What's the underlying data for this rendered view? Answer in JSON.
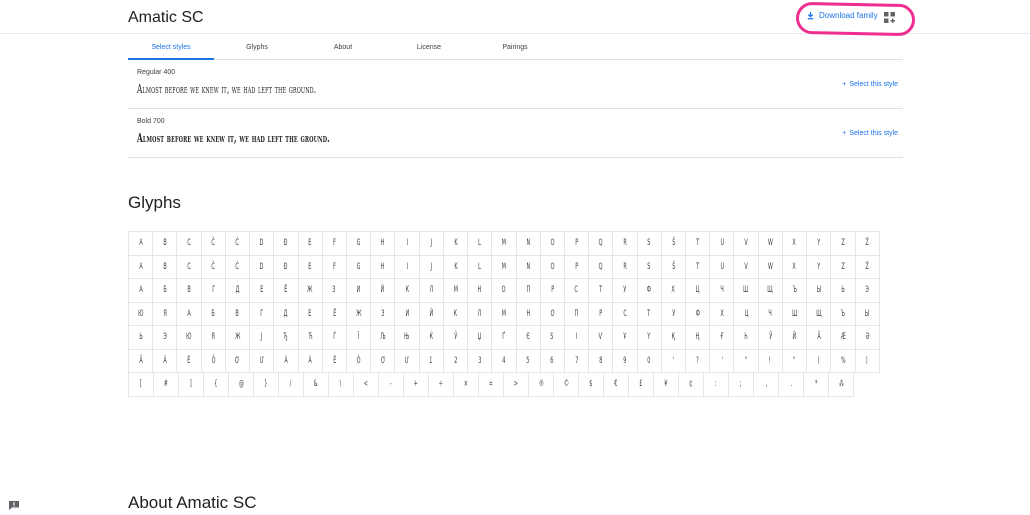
{
  "header": {
    "family_title": "Amatic SC",
    "download_label": "Download family"
  },
  "tabs": [
    "Select styles",
    "Glyphs",
    "About",
    "License",
    "Pairings"
  ],
  "active_tab": "Select styles",
  "styles": [
    {
      "name": "Regular 400",
      "sample": "Almost before we knew it, we had left the ground.",
      "action": "Select this style"
    },
    {
      "name": "Bold 700",
      "sample": "Almost before we knew it, we had left the ground.",
      "action": "Select this style"
    }
  ],
  "sections": {
    "glyphs_title": "Glyphs",
    "about_title": "About Amatic SC"
  },
  "glyph_rows": [
    [
      "A",
      "B",
      "C",
      "Č",
      "Ć",
      "D",
      "Đ",
      "E",
      "F",
      "G",
      "H",
      "I",
      "J",
      "K",
      "L",
      "M",
      "N",
      "O",
      "P",
      "Q",
      "R",
      "S",
      "Š",
      "T",
      "U",
      "V",
      "W",
      "X",
      "Y",
      "Z",
      "Ž"
    ],
    [
      "A",
      "B",
      "C",
      "Č",
      "Ć",
      "D",
      "Đ",
      "E",
      "F",
      "G",
      "H",
      "I",
      "J",
      "K",
      "L",
      "M",
      "N",
      "O",
      "P",
      "Q",
      "R",
      "S",
      "Š",
      "T",
      "U",
      "V",
      "W",
      "X",
      "Y",
      "Z",
      "Ž"
    ],
    [
      "А",
      "Б",
      "В",
      "Г",
      "Д",
      "Е",
      "Ё",
      "Ж",
      "З",
      "И",
      "Й",
      "К",
      "Л",
      "М",
      "Н",
      "О",
      "П",
      "Р",
      "С",
      "Т",
      "У",
      "Ф",
      "Х",
      "Ц",
      "Ч",
      "Ш",
      "Щ",
      "Ъ",
      "Ы",
      "Ь",
      "Э"
    ],
    [
      "Ю",
      "Я",
      "А",
      "Б",
      "В",
      "Г",
      "Д",
      "Е",
      "Ё",
      "Ж",
      "З",
      "И",
      "Й",
      "К",
      "Л",
      "М",
      "Н",
      "О",
      "П",
      "Р",
      "С",
      "Т",
      "У",
      "Ф",
      "Х",
      "Ц",
      "Ч",
      "Ш",
      "Щ",
      "Ъ",
      "Ы"
    ],
    [
      "Ь",
      "Э",
      "Ю",
      "Я",
      "Ж",
      "Ј",
      "Ђ",
      "Ћ",
      "Ѓ",
      "Ї",
      "Љ",
      "Њ",
      "Ќ",
      "Ў",
      "Џ",
      "Ґ",
      "Є",
      "Ѕ",
      "І",
      "Ѵ",
      "Ұ",
      "Ү",
      "Қ",
      "Ң",
      "Ғ",
      "Һ",
      "Ӯ",
      "Ӣ",
      "Ӑ",
      "Ӕ",
      "Ә"
    ],
    [
      "Ă",
      "Â",
      "Ê",
      "Ô",
      "Ơ",
      "Ư",
      "À",
      "Á",
      "Ê",
      "Ô",
      "Ơ",
      "Ư",
      "1",
      "2",
      "3",
      "4",
      "5",
      "6",
      "7",
      "8",
      "9",
      "0",
      "'",
      "?",
      "'",
      "\"",
      "!",
      "\"",
      "(",
      "%",
      ")"
    ],
    [
      "[",
      "#",
      "]",
      "{",
      "@",
      "}",
      "/",
      "&",
      "\\",
      "<",
      "-",
      "+",
      "÷",
      "×",
      "=",
      ">",
      "®",
      "©",
      "$",
      "€",
      "£",
      "¥",
      "¢",
      ":",
      ";",
      ",",
      ".",
      "*",
      "⁂"
    ]
  ]
}
